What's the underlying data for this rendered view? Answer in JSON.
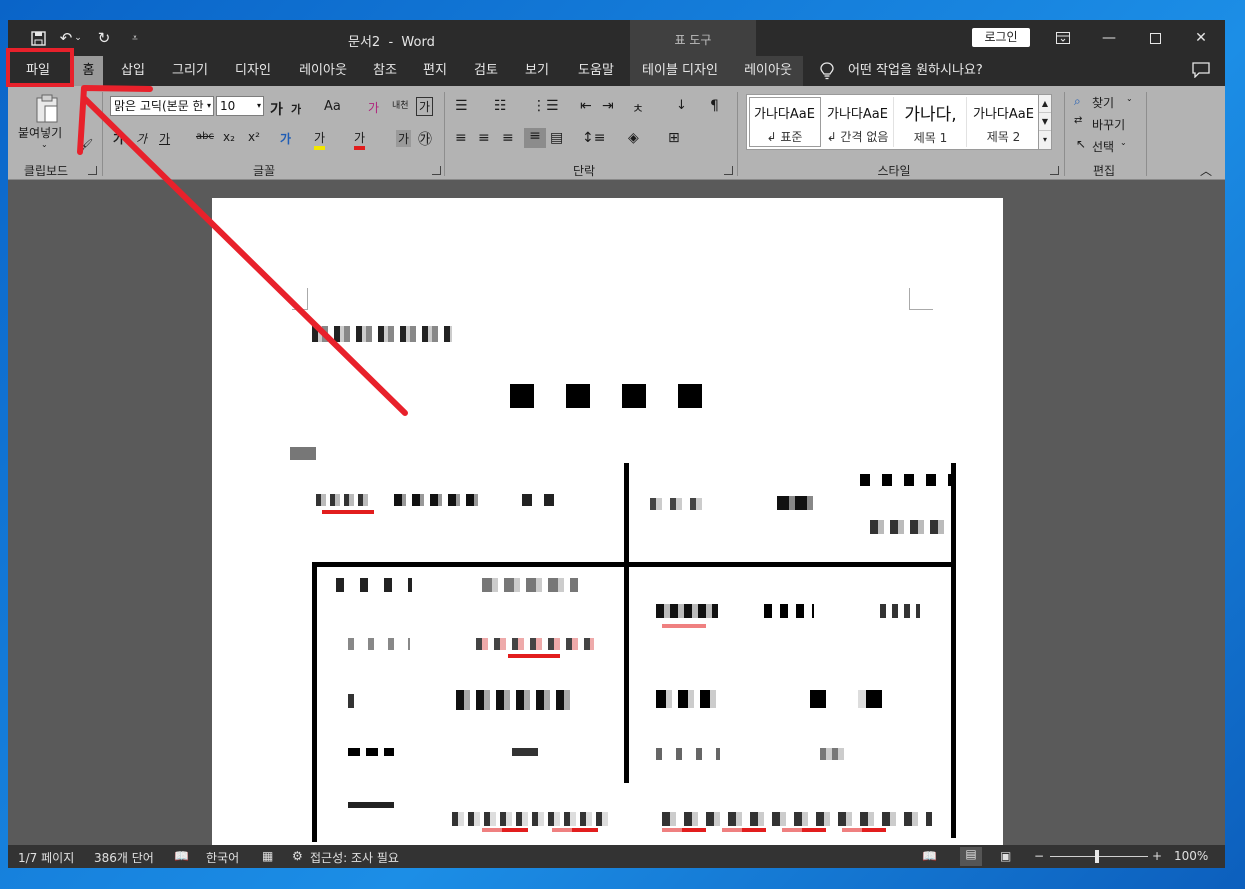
{
  "titlebar": {
    "doc_title": "문서2  -  Word",
    "context_tab_group": "표 도구",
    "login_label": "로그인"
  },
  "tabs": [
    {
      "label": "파일"
    },
    {
      "label": "홈"
    },
    {
      "label": "삽입"
    },
    {
      "label": "그리기"
    },
    {
      "label": "디자인"
    },
    {
      "label": "레이아웃"
    },
    {
      "label": "참조"
    },
    {
      "label": "편지"
    },
    {
      "label": "검토"
    },
    {
      "label": "보기"
    },
    {
      "label": "도움말"
    },
    {
      "label": "테이블 디자인"
    },
    {
      "label": "레이아웃"
    }
  ],
  "tell_me": "어떤 작업을 원하시나요?",
  "ribbon": {
    "clipboard": {
      "paste_label": "붙여넣기",
      "group_label": "클립보드"
    },
    "font": {
      "font_name": "맑은 고딕(본문 한",
      "font_size": "10",
      "group_label": "글꼴",
      "grow": "가",
      "shrink": "가",
      "case": "Aa",
      "clear": "가",
      "phonetic": "내천",
      "border_char": "가",
      "bold": "가",
      "italic": "가",
      "underline": "가",
      "strike": "abc",
      "subscript": "x₂",
      "superscript": "x²",
      "effects": "가",
      "highlight": "가",
      "color": "가",
      "shade": "가",
      "enclose": "㉮"
    },
    "paragraph": {
      "group_label": "단락"
    },
    "styles": {
      "group_label": "스타일",
      "items": [
        {
          "preview": "가나다AaE",
          "name": "↲ 표준"
        },
        {
          "preview": "가나다AaE",
          "name": "↲ 간격 없음"
        },
        {
          "preview": "가나다,",
          "name": "제목 1"
        },
        {
          "preview": "가나다AaE",
          "name": "제목 2"
        }
      ]
    },
    "editing": {
      "group_label": "편집",
      "find": "찾기",
      "replace": "바꾸기",
      "select": "선택"
    }
  },
  "statusbar": {
    "page": "1/7 페이지",
    "words": "386개 단어",
    "language": "한국어",
    "accessibility": "접근성: 조사 필요",
    "zoom": "100%"
  },
  "colors": {
    "annotation_red": "#e8212b",
    "title_bar": "#2b2b2b",
    "ribbon_bg": "#b3b3b3",
    "page_bg": "#ffffff",
    "desktop_blue": "#1c8ee6"
  },
  "icons": {
    "save": "save-icon",
    "undo": "undo-icon",
    "redo": "redo-icon",
    "tell_me": "lightbulb-icon",
    "comments": "comment-icon"
  }
}
